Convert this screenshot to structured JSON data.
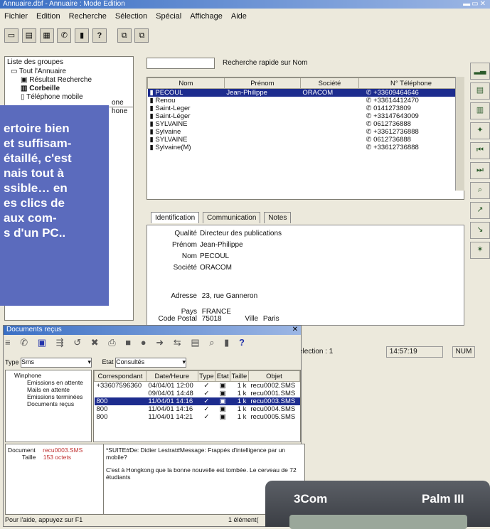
{
  "main_window": {
    "title": "Annuaire.dbf - Annuaire : Mode Edition",
    "menu": [
      "Fichier",
      "Edition",
      "Recherche",
      "Sélection",
      "Spécial",
      "Affichage",
      "Aide"
    ],
    "groups_label": "Liste des groupes",
    "tree": [
      "Tout l'Annuaire",
      "Résultat Recherche",
      "Corbeille",
      "Téléphone mobile"
    ],
    "search_label": "Recherche rapide sur Nom",
    "search_value": "",
    "columns": [
      "Nom",
      "Prénom",
      "Société",
      "N° Téléphone"
    ],
    "rows": [
      {
        "nom": "PECOUL",
        "prenom": "Jean-Philippe",
        "societe": "ORACOM",
        "tel": "+33609464646",
        "selected": true
      },
      {
        "nom": "Renou",
        "prenom": "",
        "societe": "",
        "tel": "+33614412470",
        "selected": false
      },
      {
        "nom": "Saint-Leger",
        "prenom": "",
        "societe": "",
        "tel": "0141273809",
        "selected": false
      },
      {
        "nom": "Saint-Léger",
        "prenom": "",
        "societe": "",
        "tel": "+33147643009",
        "selected": false
      },
      {
        "nom": "SYLVAINE",
        "prenom": "",
        "societe": "",
        "tel": "0612736888",
        "selected": false
      },
      {
        "nom": "Sylvaine",
        "prenom": "",
        "societe": "",
        "tel": "+33612736888",
        "selected": false
      },
      {
        "nom": "SYLVAINE",
        "prenom": "",
        "societe": "",
        "tel": "0612736888",
        "selected": false
      },
      {
        "nom": "Sylvaine(M)",
        "prenom": "",
        "societe": "",
        "tel": "+33612736888",
        "selected": false
      }
    ],
    "tabs": [
      "Identification",
      "Communication",
      "Notes"
    ],
    "fields": [
      {
        "label": "Qualité",
        "value": "Directeur des publications"
      },
      {
        "label": "Prénom",
        "value": "Jean-Philippe"
      },
      {
        "label": "Nom",
        "value": "PECOUL"
      },
      {
        "label": "Société",
        "value": "ORACOM"
      }
    ],
    "adresse_label": "Adresse",
    "adresse_value": "23, rue Ganneron",
    "cp_label": "Code Postal",
    "cp_value": "75018",
    "ville_label": "Ville",
    "ville_value": "Paris",
    "pays_label": "Pays",
    "pays_value": "FRANCE",
    "status_selection": "election : 1",
    "status_time": "14:57:19",
    "status_num": "NUM"
  },
  "overlay": {
    "lines": [
      "ertoire bien",
      "et suffisam-",
      "étaillé, c'est",
      "nais tout à",
      "ssible… en",
      "es clics de",
      "aux com-",
      "s d'un PC.."
    ]
  },
  "docs_window": {
    "title": "Documents reçus",
    "type_label": "Type",
    "type_value": "Sms",
    "etat_label": "Etat",
    "etat_value": "Consultés",
    "tree": [
      "Winphone",
      "Emissions en attente",
      "Mails en attente",
      "Emissions terminées",
      "Documents reçus"
    ],
    "columns": [
      "Correspondant",
      "Date/Heure",
      "Type",
      "Etat",
      "Taille",
      "Objet"
    ],
    "rows": [
      {
        "corr": "+33607596360",
        "date": "04/04/01 12:00",
        "taille": "1 k",
        "objet": "recu0002.SMS",
        "selected": false
      },
      {
        "corr": "",
        "date": "09/04/01 14:48",
        "taille": "1 k",
        "objet": "recu0001.SMS",
        "selected": false
      },
      {
        "corr": "800",
        "date": "11/04/01 14:16",
        "taille": "1 k",
        "objet": "recu0003.SMS",
        "selected": true
      },
      {
        "corr": "800",
        "date": "11/04/01 14:16",
        "taille": "1 k",
        "objet": "recu0004.SMS",
        "selected": false
      },
      {
        "corr": "800",
        "date": "11/04/01 14:21",
        "taille": "1 k",
        "objet": "recu0005.SMS",
        "selected": false
      }
    ],
    "doc_label": "Document",
    "doc_value": "recu0003.SMS",
    "taille_label": "Taille",
    "taille_value": "153 octets",
    "message_line1": "*SUITE#De: Didier Lestrat#Message: Frappés d'intelligence par un mobile?",
    "message_line2": "C'est à Hongkong que la bonne nouvelle est tombée. Le cerveau de 72 étudiants",
    "status_help": "Pour l'aide, appuyez sur F1",
    "status_count": "1 élément("
  },
  "palm": {
    "brand": "3Com",
    "model": "Palm III"
  }
}
